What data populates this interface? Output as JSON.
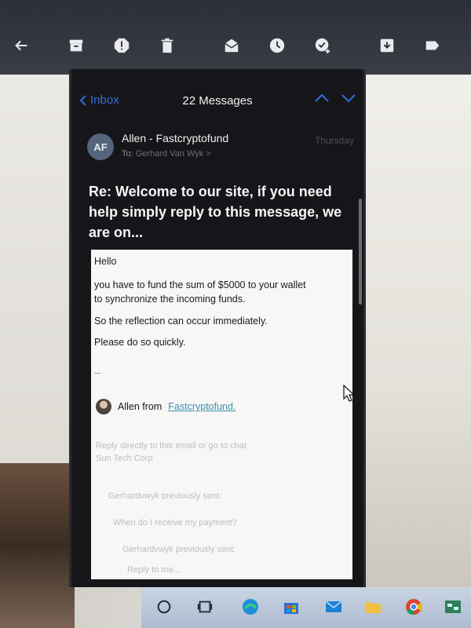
{
  "toolbar": {
    "icons": [
      "back-arrow-icon",
      "archive-icon",
      "report-spam-icon",
      "trash-icon",
      "mark-unread-icon",
      "snooze-icon",
      "add-task-icon",
      "move-to-icon",
      "label-icon"
    ]
  },
  "mail": {
    "back_label": "Inbox",
    "message_count": "22 Messages",
    "avatar_initials": "AF",
    "sender": "Allen - Fastcryptofund",
    "to_prefix": "To:",
    "to_name": "Gerhard Van Wyk",
    "to_chevron": ">",
    "date": "Thursday",
    "subject": "Re: Welcome to our site, if you need help simply reply to this message, we are on...",
    "body": {
      "greeting": "Hello",
      "line1": "you have to fund the sum of $5000 to your wallet",
      "line2": "to synchronize the incoming funds.",
      "line3": "So the reflection can occur immediately.",
      "line4": "Please do so quickly.",
      "separator": "--",
      "sig_prefix": "Allen from",
      "sig_link": "Fastcryptofund."
    },
    "quoted": {
      "q1": "Reply directly to this email or go to chat",
      "q2": "Sun Tech Corp",
      "q3": "Gerhardvwyk previously sent:",
      "q4": "When do I receive my payment?",
      "q5": "Gerhardvwyk previously sent:",
      "q6": "Reply to me..."
    }
  },
  "taskbar": {
    "icons": [
      "search-circle-icon",
      "task-view-icon",
      "edge-icon",
      "store-icon",
      "mail-icon",
      "file-explorer-icon",
      "chrome-icon",
      "network-icon"
    ]
  },
  "colors": {
    "accent_blue": "#2f6fd6",
    "panel_bg": "#16161a",
    "link": "#3b8fb0"
  }
}
